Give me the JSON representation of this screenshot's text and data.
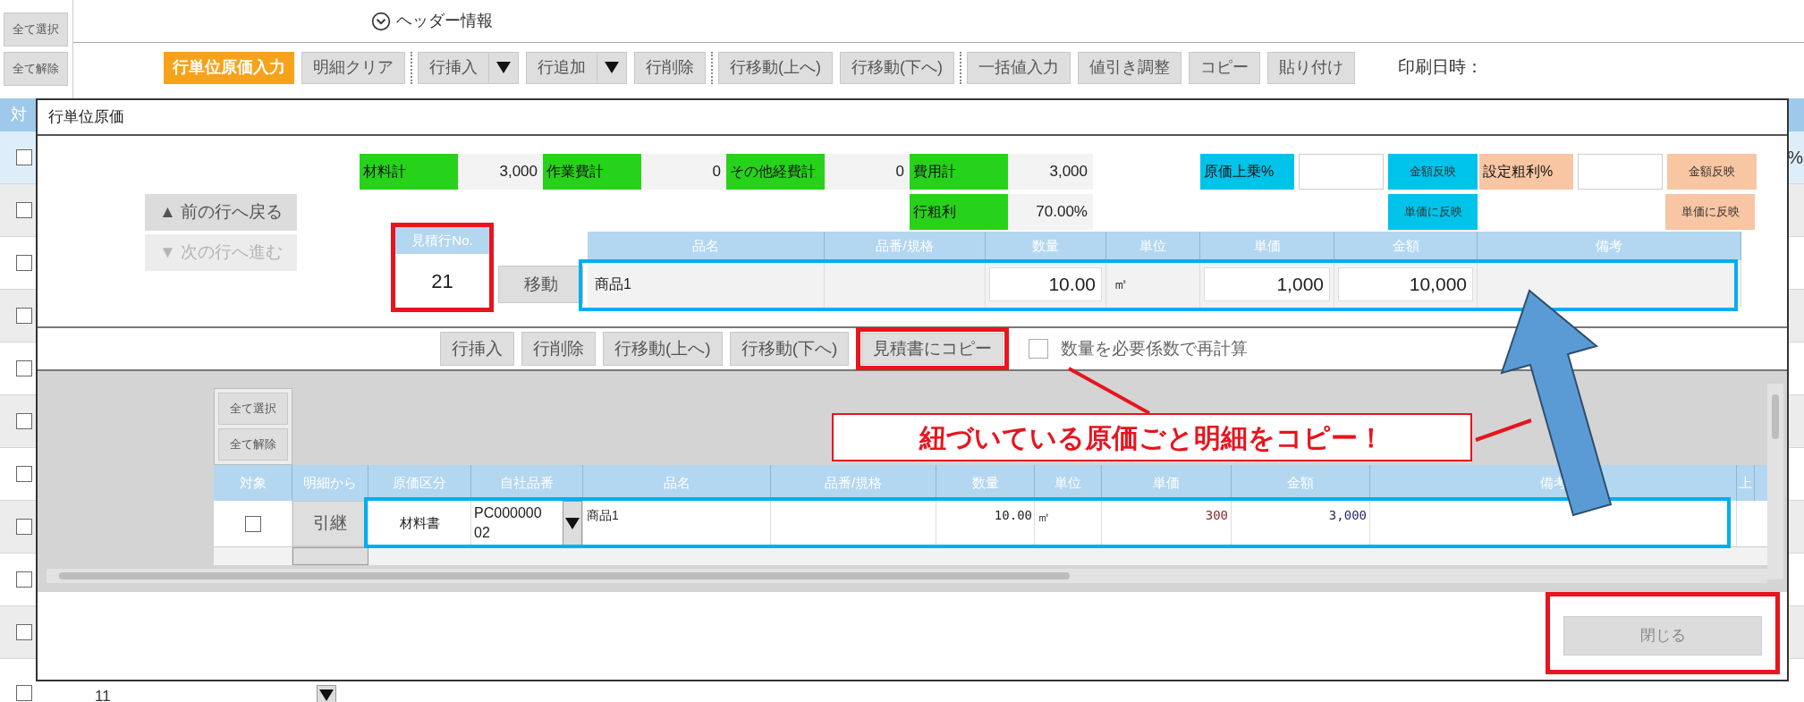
{
  "select_buttons": [
    {
      "label": "全て選択"
    },
    {
      "label": "全て解除"
    }
  ],
  "header_toggle": {
    "label": "ヘッダー情報",
    "expanded": false
  },
  "toolbar_groups": [
    {
      "buttons": [
        {
          "label": "行単位原価入力",
          "kind": "primary"
        },
        {
          "label": "明細クリア",
          "kind": "plain"
        }
      ]
    },
    {
      "buttons": [
        {
          "label": "行挿入",
          "kind": "split"
        },
        {
          "label": "行追加",
          "kind": "split"
        },
        {
          "label": "行削除",
          "kind": "plain"
        }
      ]
    },
    {
      "buttons": [
        {
          "label": "行移動(上へ)",
          "kind": "plain"
        },
        {
          "label": "行移動(下へ)",
          "kind": "plain"
        }
      ]
    },
    {
      "buttons": [
        {
          "label": "一括値入力",
          "kind": "plain"
        },
        {
          "label": "値引き調整",
          "kind": "plain"
        },
        {
          "label": "コピー",
          "kind": "plain"
        },
        {
          "label": "貼り付け",
          "kind": "plain"
        }
      ]
    }
  ],
  "print_date_label": "印刷日時：",
  "background_grid": {
    "header": "対",
    "rows": [
      {
        "checked": false,
        "selected": true,
        "right_edge_text": "%"
      },
      {
        "checked": false,
        "selected": false
      },
      {
        "checked": false,
        "selected": false
      },
      {
        "checked": false,
        "selected": false
      },
      {
        "checked": false,
        "selected": false
      },
      {
        "checked": false,
        "selected": false
      },
      {
        "checked": false,
        "selected": false
      },
      {
        "checked": false,
        "selected": false
      },
      {
        "checked": false,
        "selected": false
      },
      {
        "checked": false,
        "selected": false
      },
      {
        "checked": false,
        "selected": false,
        "number": "11",
        "has_dropdown": true
      }
    ]
  },
  "dialog": {
    "title": "行単位原価",
    "totals": [
      {
        "label": "材料計",
        "value": "3,000"
      },
      {
        "label": "作業費計",
        "value": "0"
      },
      {
        "label": "その他経費計",
        "value": "0"
      },
      {
        "label": "費用計",
        "value": "3,000"
      }
    ],
    "gross_profit": {
      "label": "行粗利",
      "value": "70.00%"
    },
    "adjusters": [
      {
        "kind": "markup",
        "label": "原価上乗%",
        "buttons": [
          "金額反映",
          "単価に反映"
        ]
      },
      {
        "kind": "margin",
        "label": "設定粗利%",
        "buttons": [
          "金額反映",
          "単価に反映"
        ]
      }
    ],
    "nav_buttons": [
      {
        "label": "▲ 前の行へ戻る",
        "disabled": false
      },
      {
        "label": "▼ 次の行へ進む",
        "disabled": true
      }
    ],
    "row_number": {
      "label": "見積行No.",
      "value": "21",
      "highlighted": true
    },
    "move_button": "移動",
    "item_table": {
      "columns": [
        "品名",
        "品番/規格",
        "数量",
        "単位",
        "単価",
        "金額",
        "備考"
      ],
      "cells": [
        {
          "kind": "text",
          "text": "商品1"
        },
        {
          "kind": "text"
        },
        {
          "kind": "input",
          "text": "10.00"
        },
        {
          "kind": "text",
          "text": "㎡"
        },
        {
          "kind": "input",
          "text": "1,000"
        },
        {
          "kind": "input",
          "text": "10,000"
        },
        {
          "kind": "text"
        }
      ]
    },
    "actions": [
      {
        "label": "行挿入"
      },
      {
        "label": "行削除"
      },
      {
        "label": "行移動(上へ)"
      },
      {
        "label": "行移動(下へ)"
      },
      {
        "label": "見積書にコピー",
        "highlighted": true
      }
    ],
    "recalc": {
      "label": "数量を必要係数で再計算",
      "checked": false
    },
    "cost_grid": {
      "select_buttons": [
        "全て選択",
        "全て解除"
      ],
      "columns": [
        "対象",
        "明細から",
        "原価区分",
        "自社品番",
        "品名",
        "品番/規格",
        "数量",
        "単位",
        "単価",
        "金額",
        "備考",
        "上"
      ],
      "rows": [
        {
          "checked": false,
          "carry_button": "引継",
          "category": "材料書",
          "code": "PC00000002",
          "name": "商品1",
          "quantity": "10.00",
          "unit": "㎡",
          "price": "300",
          "amount": "3,000"
        }
      ]
    },
    "close_button": "閉じる"
  },
  "callout": "紐づいている原価ごと明細をコピー！"
}
